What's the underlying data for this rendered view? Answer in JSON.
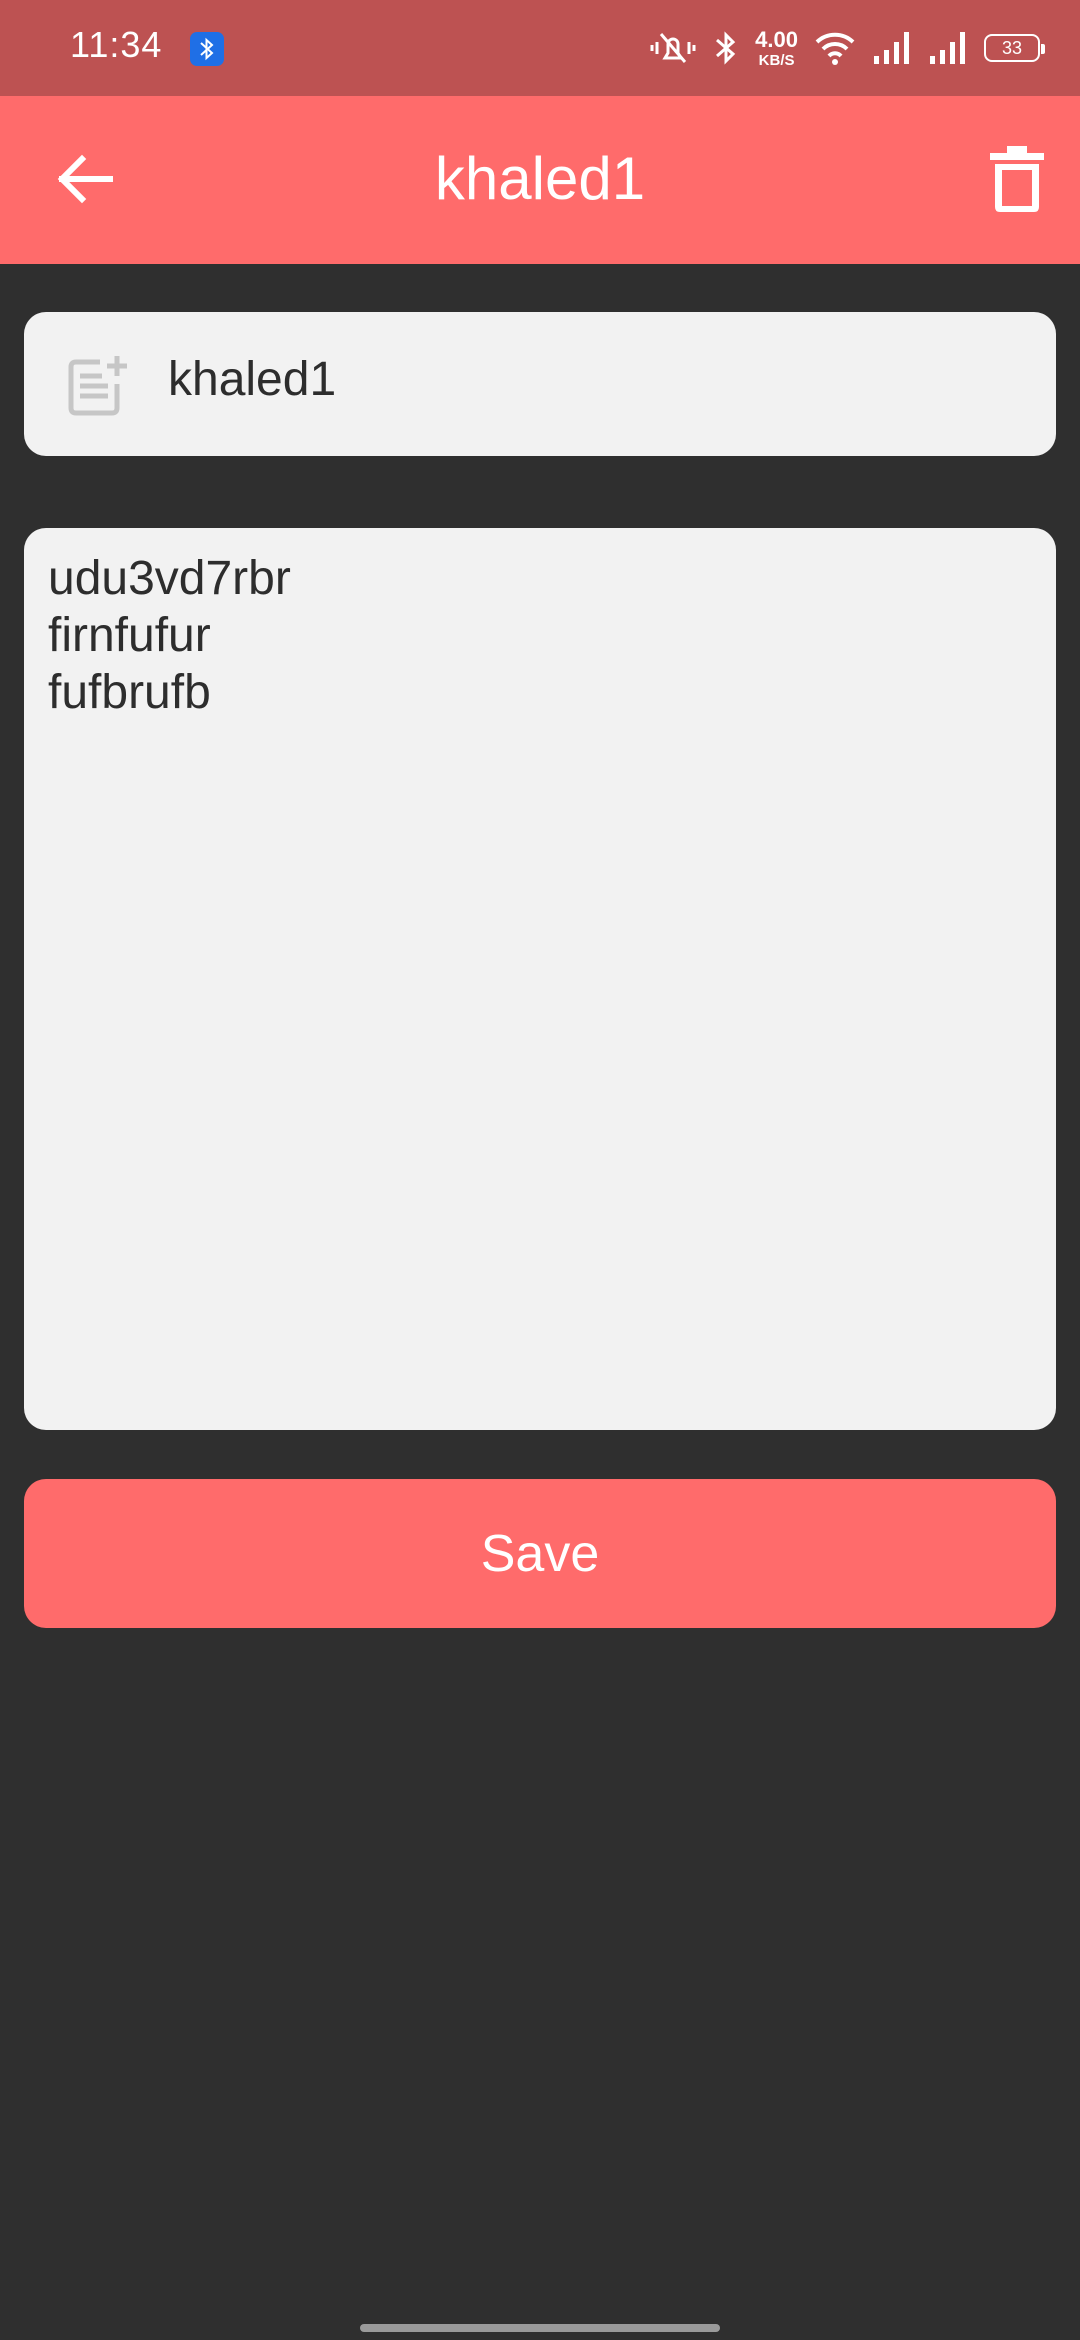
{
  "status_bar": {
    "time": "11:34",
    "network_speed_value": "4.00",
    "network_speed_unit": "KB/S",
    "battery_level": "33",
    "icons": [
      "bluetooth-badge-icon",
      "vibrate-mute-icon",
      "bluetooth-icon",
      "wifi-icon",
      "signal-icon",
      "signal-icon",
      "battery-icon"
    ]
  },
  "app_bar": {
    "title": "khaled1",
    "back_icon": "arrow-left-icon",
    "delete_icon": "trash-icon",
    "color": "#ff6b6b"
  },
  "note": {
    "title_value": "khaled1",
    "title_icon": "note-add-icon",
    "body_value": "udu3vd7rbr\nfirnfufur\nfufbrufb"
  },
  "actions": {
    "save_label": "Save"
  },
  "colors": {
    "accent": "#ff6b6b",
    "status_bar": "#bd5252",
    "background": "#2f2f2f",
    "field": "#f2f2f2"
  }
}
